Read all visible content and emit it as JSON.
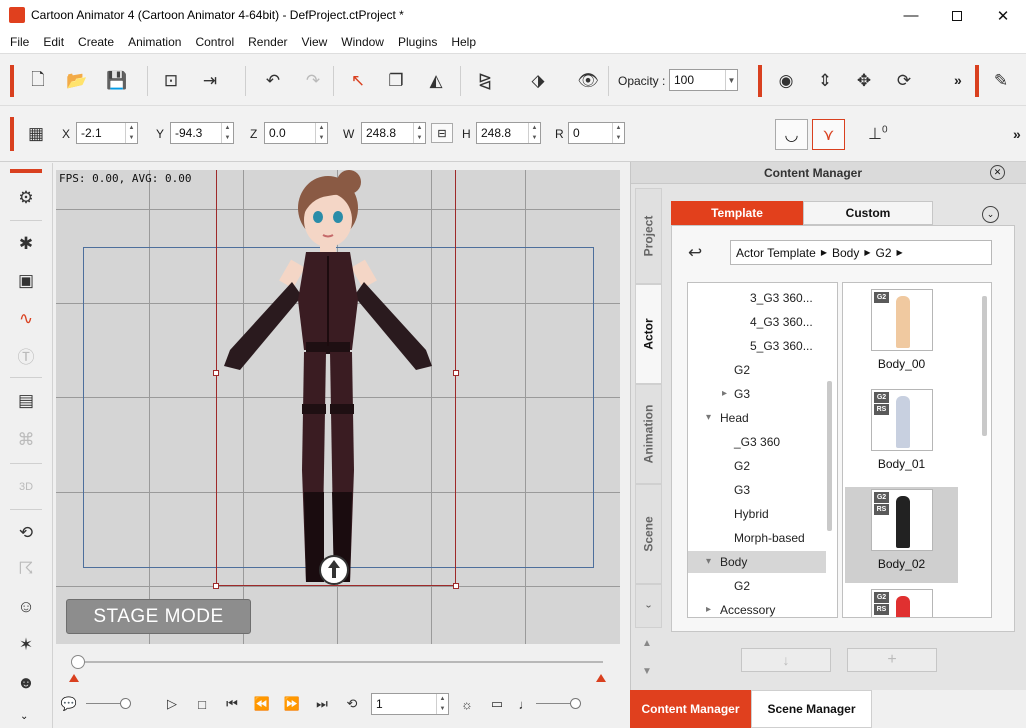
{
  "window": {
    "title": "Cartoon Animator 4  (Cartoon Animator 4-64bit) - DefProject.ctProject *",
    "minimize_icon": "minimize-icon",
    "maximize_icon": "maximize-icon",
    "close_icon": "close-icon"
  },
  "menu": [
    "File",
    "Edit",
    "Create",
    "Animation",
    "Control",
    "Render",
    "View",
    "Window",
    "Plugins",
    "Help"
  ],
  "toolbar1": {
    "opacity_label": "Opacity :",
    "opacity_value": "100",
    "more_label": "»"
  },
  "toolbar2": {
    "x_label": "X",
    "x_value": "-2.1",
    "y_label": "Y",
    "y_value": "-94.3",
    "z_label": "Z",
    "z_value": "0.0",
    "w_label": "W",
    "w_value": "248.8",
    "h_label": "H",
    "h_value": "248.8",
    "r_label": "R",
    "r_value": "0",
    "layer_num": "0",
    "more_label": "»"
  },
  "stage": {
    "fps_text": "FPS: 0.00, AVG: 0.00",
    "mode_label": "STAGE MODE"
  },
  "timeline": {
    "frame_value": "1"
  },
  "content_manager": {
    "title": "Content Manager",
    "side_tabs": [
      "Project",
      "Actor",
      "Animation",
      "Scene"
    ],
    "active_side_tab": "Actor",
    "tabs": {
      "template": "Template",
      "custom": "Custom"
    },
    "breadcrumb": [
      "Actor Template",
      "Body",
      "G2"
    ],
    "tree": [
      {
        "label": "3_G3 360...",
        "indent": 3,
        "arrow": ""
      },
      {
        "label": "4_G3 360...",
        "indent": 3,
        "arrow": ""
      },
      {
        "label": "5_G3 360...",
        "indent": 3,
        "arrow": ""
      },
      {
        "label": "G2",
        "indent": 2,
        "arrow": ""
      },
      {
        "label": "G3",
        "indent": 2,
        "arrow": "▸"
      },
      {
        "label": "Head",
        "indent": 1,
        "arrow": "▾"
      },
      {
        "label": "_G3 360",
        "indent": 2,
        "arrow": ""
      },
      {
        "label": "G2",
        "indent": 2,
        "arrow": ""
      },
      {
        "label": "G3",
        "indent": 2,
        "arrow": ""
      },
      {
        "label": "Hybrid",
        "indent": 2,
        "arrow": ""
      },
      {
        "label": "Morph-based",
        "indent": 2,
        "arrow": ""
      },
      {
        "label": "Body",
        "indent": 1,
        "arrow": "▾",
        "selected": true
      },
      {
        "label": "G2",
        "indent": 2,
        "arrow": ""
      },
      {
        "label": "Accessory",
        "indent": 1,
        "arrow": "▸"
      }
    ],
    "thumbnails": [
      {
        "label": "Body_00",
        "badges": [
          "G2"
        ]
      },
      {
        "label": "Body_01",
        "badges": [
          "G2",
          "RS"
        ]
      },
      {
        "label": "Body_02",
        "badges": [
          "G2",
          "RS"
        ],
        "selected": true
      },
      {
        "label": "",
        "badges": [
          "G2",
          "RS"
        ]
      }
    ]
  },
  "bottom_tabs": {
    "content_manager": "Content Manager",
    "scene_manager": "Scene Manager"
  },
  "colors": {
    "accent": "#e0401e",
    "redbar": "#d9401f"
  }
}
